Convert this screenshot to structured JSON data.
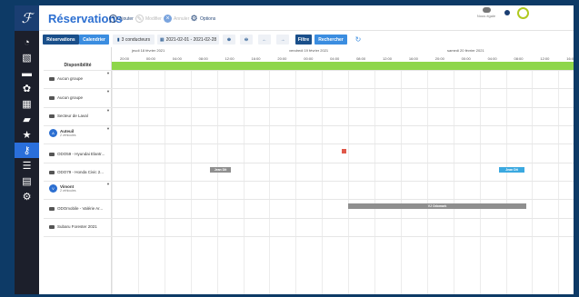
{
  "header": {
    "title": "Réservations",
    "actions": [
      {
        "label": "Ajouter",
        "enabled": true
      },
      {
        "label": "Modifier",
        "enabled": false
      },
      {
        "label": "Annuler",
        "enabled": false
      },
      {
        "label": "Options",
        "enabled": true
      }
    ],
    "notif_label": "Nous égale"
  },
  "toolbar": {
    "tab_reservations": "Réservations",
    "tab_calendar": "Calendrier",
    "drivers": "3 conducteurs",
    "date_range": "2021-02-01 - 2021-02-28",
    "filter": "Filtre",
    "search": "Rechercher"
  },
  "grid": {
    "days": [
      "jeudi 18 février 2021",
      "vendredi 19 février 2021",
      "samedi 20 février 2021"
    ],
    "times": [
      "20:00",
      "00:00",
      "04:00",
      "08:00",
      "12:00",
      "16:00",
      "20:00",
      "00:00",
      "04:00",
      "08:00",
      "12:00",
      "16:00",
      "20:00",
      "00:00",
      "04:00",
      "08:00",
      "12:00",
      "16:00"
    ],
    "availability_label": "Disponibilité",
    "rows": [
      {
        "label": "Aucun groupe",
        "type": "vehicle"
      },
      {
        "label": "Aucun groupe",
        "type": "vehicle"
      },
      {
        "label": "Secteur de Laval",
        "type": "vehicle"
      },
      {
        "label": "Auteuil",
        "sub": "2 véhicules",
        "type": "group"
      },
      {
        "label": "ODO59 - Hyundai Elantr...",
        "type": "vehicle"
      },
      {
        "label": "ODO79 - Honda Civic 2...",
        "type": "vehicle"
      },
      {
        "label": "Vimont",
        "sub": "2 véhicules",
        "type": "group"
      },
      {
        "label": "ODOmobile - Valérie Ar...",
        "type": "vehicle"
      },
      {
        "label": "Subaru Forester 2021",
        "type": "vehicle"
      }
    ],
    "reservations": [
      {
        "label": "",
        "color": "#e0584a"
      },
      {
        "label": "Jean Dit",
        "color": "#8f8f8f"
      },
      {
        "label": "Jean Dit",
        "color": "#3ba9e0"
      },
      {
        "label": "VJ Odomark",
        "color": "#8f8f8f"
      }
    ]
  },
  "colors": {
    "accent": "#2c6fd1",
    "availability": "#8ed64a",
    "frame": "#0d3a66"
  }
}
